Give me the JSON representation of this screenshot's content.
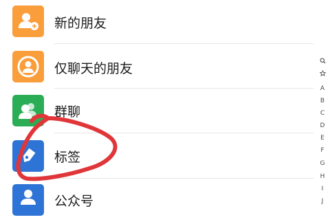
{
  "contacts_menu": {
    "items": [
      {
        "label": "新的朋友",
        "icon": "add-user-icon",
        "color": "#FA9D3B"
      },
      {
        "label": "仅聊天的朋友",
        "icon": "chat-only-user-icon",
        "color": "#FA9D3B"
      },
      {
        "label": "群聊",
        "icon": "group-chat-icon",
        "color": "#2BAD56"
      },
      {
        "label": "标签",
        "icon": "tag-icon",
        "color": "#2E73D6"
      },
      {
        "label": "公众号",
        "icon": "official-account-icon",
        "color": "#2E73D6"
      }
    ]
  },
  "index_bar": {
    "search_icon": "search-icon",
    "star_icon": "star-icon",
    "letters": [
      "A",
      "B",
      "C",
      "D",
      "E",
      "F",
      "G",
      "H",
      "I",
      "J"
    ]
  },
  "annotation": {
    "color": "#E0363A",
    "shape": "hand-drawn circle around 标签"
  }
}
